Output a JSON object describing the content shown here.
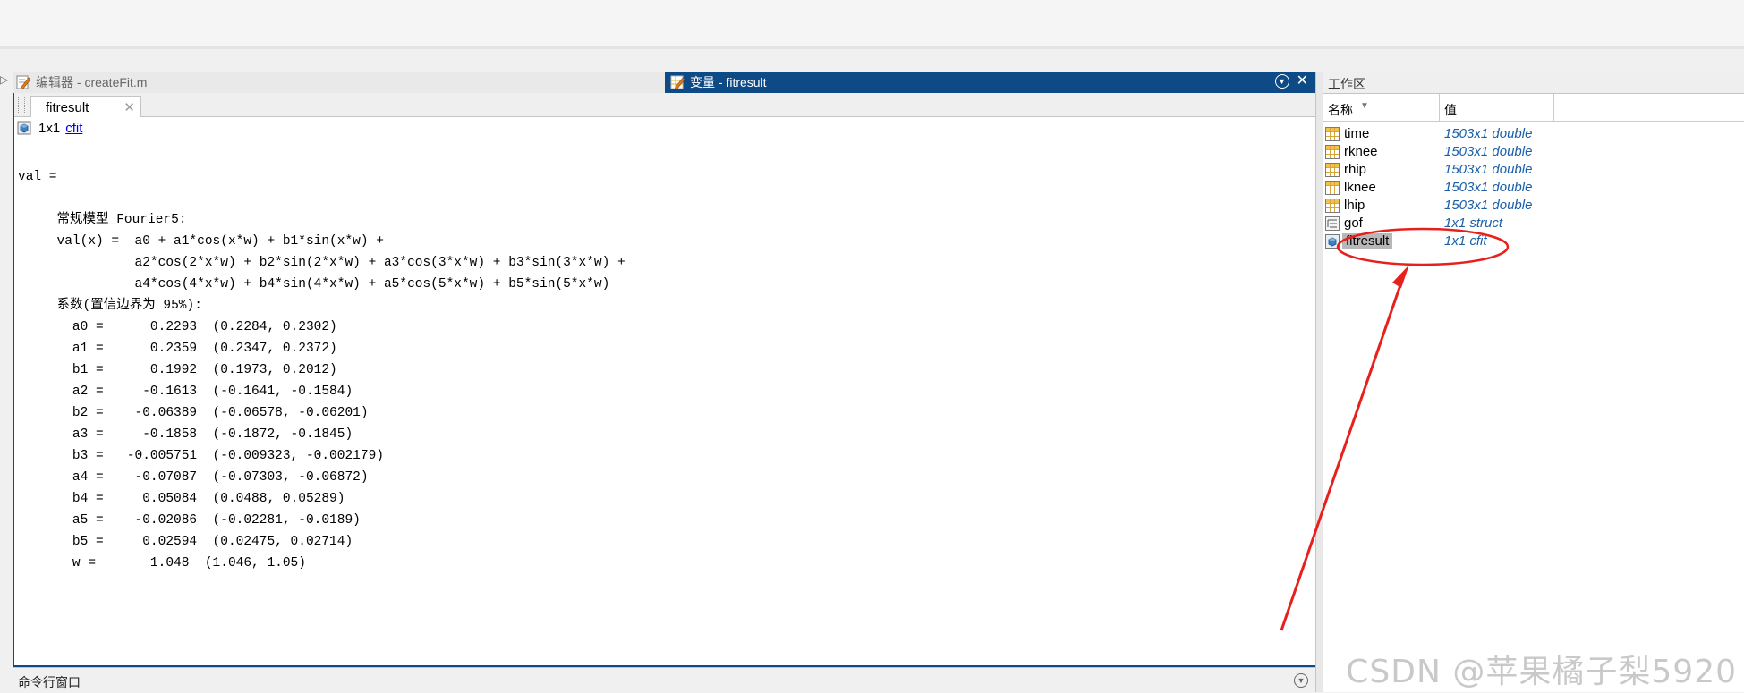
{
  "editor": {
    "tab_label": "编辑器 - createFit.m"
  },
  "variables_tab": {
    "title": "变量 - fitresult"
  },
  "document": {
    "tab_label": "fitresult",
    "size": "1x1",
    "class_link": "cfit",
    "output_lines": [
      "",
      "val =",
      "",
      "     常规模型 Fourier5:",
      "     val(x) =  a0 + a1*cos(x*w) + b1*sin(x*w) +",
      "               a2*cos(2*x*w) + b2*sin(2*x*w) + a3*cos(3*x*w) + b3*sin(3*x*w) +",
      "               a4*cos(4*x*w) + b4*sin(4*x*w) + a5*cos(5*x*w) + b5*sin(5*x*w)",
      "     系数(置信边界为 95%):",
      "       a0 =      0.2293  (0.2284, 0.2302)",
      "       a1 =      0.2359  (0.2347, 0.2372)",
      "       b1 =      0.1992  (0.1973, 0.2012)",
      "       a2 =     -0.1613  (-0.1641, -0.1584)",
      "       b2 =    -0.06389  (-0.06578, -0.06201)",
      "       a3 =     -0.1858  (-0.1872, -0.1845)",
      "       b3 =   -0.005751  (-0.009323, -0.002179)",
      "       a4 =    -0.07087  (-0.07303, -0.06872)",
      "       b4 =     0.05084  (0.0488, 0.05289)",
      "       a5 =    -0.02086  (-0.02281, -0.0189)",
      "       b5 =     0.02594  (0.02475, 0.02714)",
      "       w =       1.048  (1.046, 1.05)"
    ]
  },
  "command_window": {
    "label": "命令行窗口"
  },
  "workspace": {
    "title": "工作区",
    "col_name": "名称",
    "col_value": "值",
    "variables": [
      {
        "name": "time",
        "value": "1503x1 double",
        "icon": "matrix-icon"
      },
      {
        "name": "rknee",
        "value": "1503x1 double",
        "icon": "matrix-icon"
      },
      {
        "name": "rhip",
        "value": "1503x1 double",
        "icon": "matrix-icon"
      },
      {
        "name": "lknee",
        "value": "1503x1 double",
        "icon": "matrix-icon"
      },
      {
        "name": "lhip",
        "value": "1503x1 double",
        "icon": "matrix-icon"
      },
      {
        "name": "gof",
        "value": "1x1 struct",
        "icon": "struct-icon"
      },
      {
        "name": "fitresult",
        "value": "1x1 cfit",
        "icon": "cfit-icon",
        "selected": true
      }
    ]
  },
  "watermark": "CSDN @苹果橘子梨5920",
  "colors": {
    "accent": "#0e4a86",
    "annotation": "#e8201c",
    "value_text": "#1a5fa8"
  }
}
